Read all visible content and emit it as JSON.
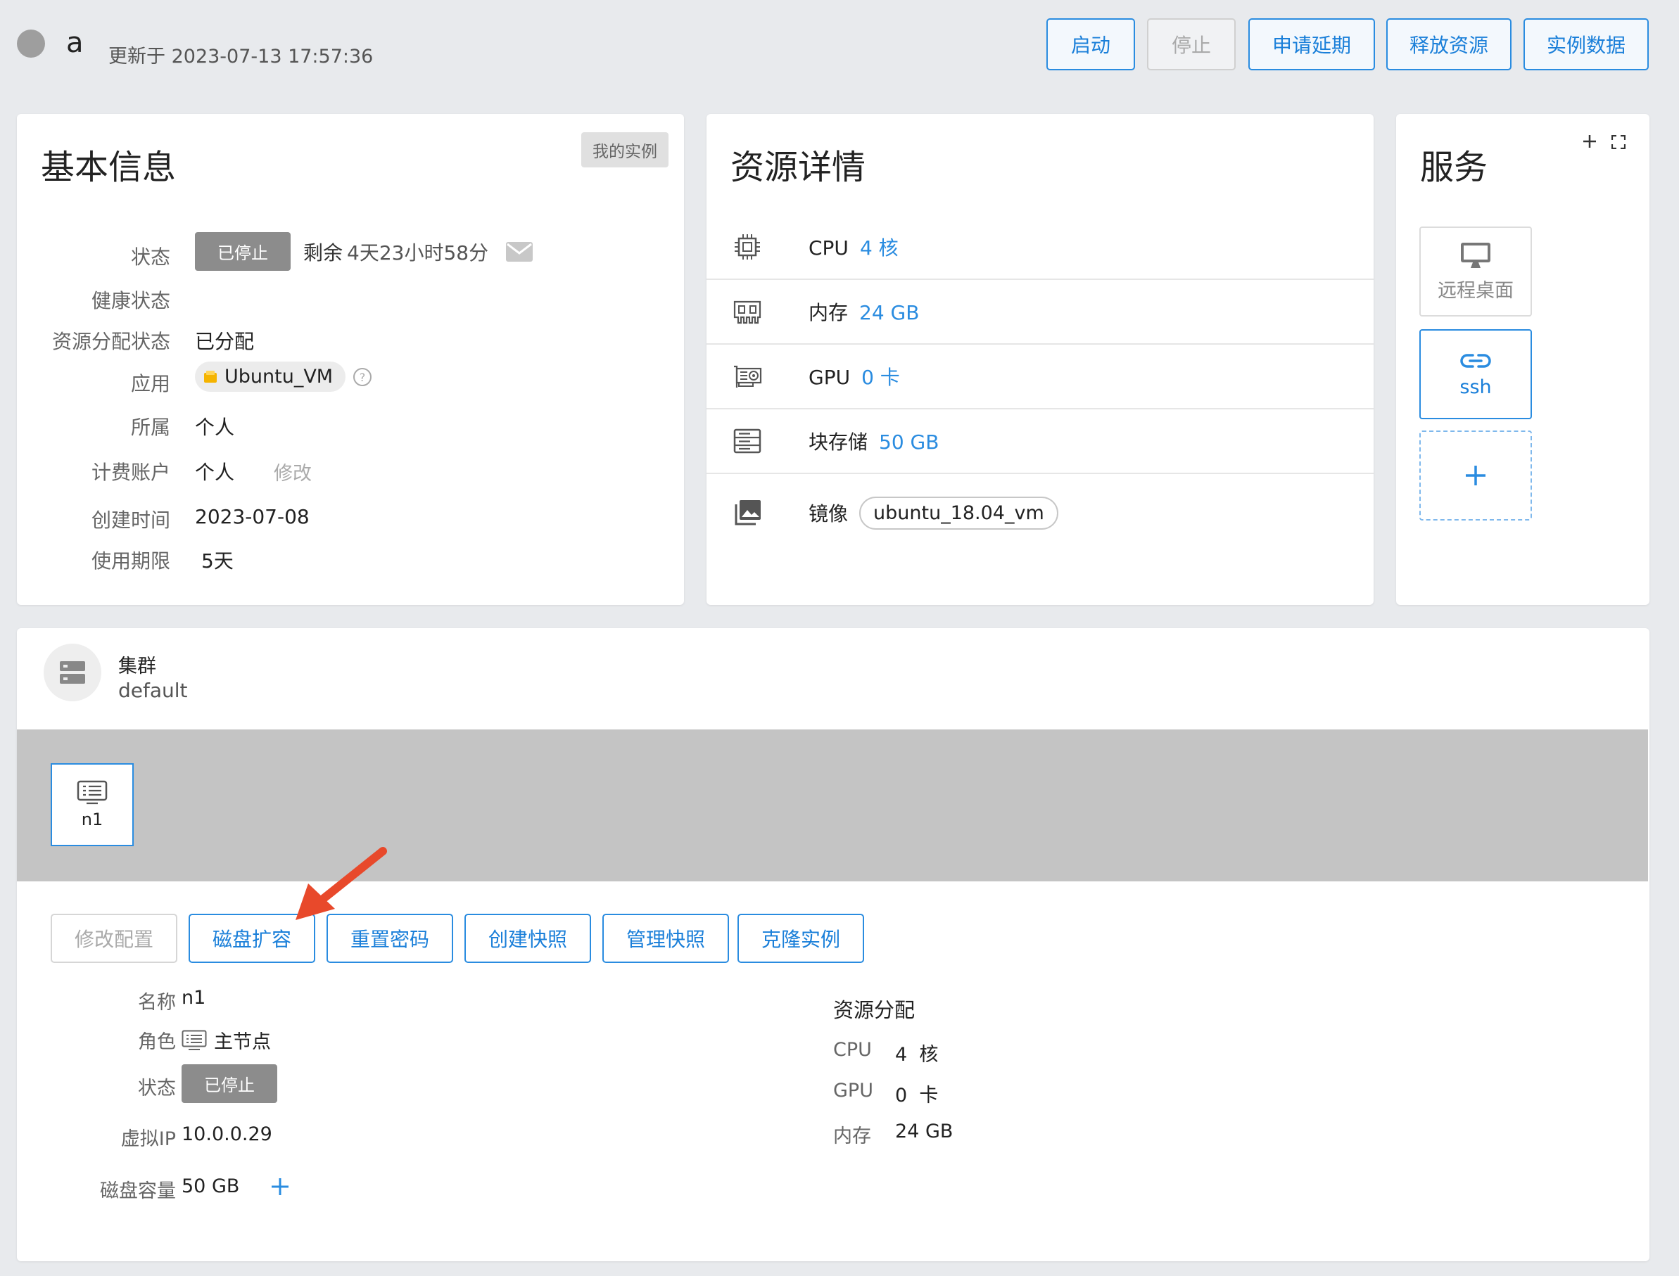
{
  "header": {
    "instance_name": "a",
    "updated_text": "更新于 2023-07-13 17:57:36",
    "buttons": {
      "start": "启动",
      "stop": "停止",
      "extend": "申请延期",
      "release": "释放资源",
      "data": "实例数据"
    }
  },
  "basic_info": {
    "title": "基本信息",
    "tag": "我的实例",
    "labels": {
      "status": "状态",
      "health": "健康状态",
      "allocation": "资源分配状态",
      "app": "应用",
      "owner": "所属",
      "billing": "计费账户",
      "created": "创建时间",
      "period": "使用期限"
    },
    "values": {
      "status": "已停止",
      "remaining_label": "剩余",
      "remaining_value": "4天23小时58分",
      "allocation": "已分配",
      "app": "Ubuntu_VM",
      "owner": "个人",
      "billing": "个人",
      "billing_modify": "修改",
      "created": "2023-07-08",
      "period": "5天"
    }
  },
  "resources": {
    "title": "资源详情",
    "rows": [
      {
        "label": "CPU",
        "value": "4 核",
        "icon": "cpu-icon"
      },
      {
        "label": "内存",
        "value": "24 GB",
        "icon": "memory-icon"
      },
      {
        "label": "GPU",
        "value": "0 卡",
        "icon": "gpu-icon"
      },
      {
        "label": "块存储",
        "value": "50 GB",
        "icon": "storage-icon"
      },
      {
        "label": "镜像",
        "value": "ubuntu_18.04_vm",
        "icon": "image-icon"
      }
    ]
  },
  "services": {
    "title": "服务",
    "add_icon": "plus-icon",
    "fullscreen_icon": "fullscreen-icon",
    "tiles": [
      {
        "label": "远程桌面",
        "icon": "monitor-icon"
      },
      {
        "label": "ssh",
        "icon": "link-icon"
      }
    ]
  },
  "cluster": {
    "title": "集群",
    "name": "default",
    "node": "n1",
    "actions": [
      "修改配置",
      "磁盘扩容",
      "重置密码",
      "创建快照",
      "管理快照",
      "克隆实例"
    ],
    "details": {
      "labels": {
        "name": "名称",
        "role": "角色",
        "status": "状态",
        "ip": "虚拟IP",
        "disk": "磁盘容量"
      },
      "values": {
        "name": "n1",
        "role": "主节点",
        "status": "已停止",
        "ip": "10.0.0.29",
        "disk": "50 GB"
      }
    },
    "allocation": {
      "title": "资源分配",
      "rows": [
        {
          "label": "CPU",
          "value": "4  核"
        },
        {
          "label": "GPU",
          "value": "0  卡"
        },
        {
          "label": "内存",
          "value": "24 GB"
        }
      ]
    }
  },
  "colors": {
    "accent": "#2a8ce0",
    "background": "#e8eaed",
    "stopped_badge": "#8c8c8c",
    "annotation_arrow": "#e8492b"
  }
}
